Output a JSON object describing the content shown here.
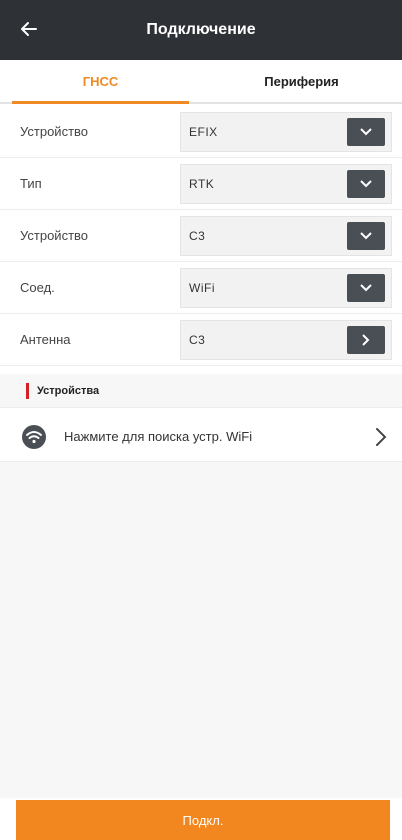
{
  "header": {
    "title": "Подключение",
    "back_icon": "arrow-left-icon"
  },
  "tabs": [
    {
      "label": "ГНСС",
      "active": true
    },
    {
      "label": "Периферия",
      "active": false
    }
  ],
  "rows": [
    {
      "label": "Устройство",
      "value": "EFIX",
      "action_icon": "chevron-down-icon"
    },
    {
      "label": "Тип",
      "value": "RTK",
      "action_icon": "chevron-down-icon"
    },
    {
      "label": "Устройство",
      "value": "C3",
      "action_icon": "chevron-down-icon"
    },
    {
      "label": "Соед.",
      "value": "WiFi",
      "action_icon": "chevron-down-icon"
    },
    {
      "label": "Антенна",
      "value": "C3",
      "action_icon": "chevron-right-icon"
    }
  ],
  "devices_section": {
    "title": "Устройства"
  },
  "wifi_search": {
    "label": "Нажмите для поиска устр. WiFi",
    "icon": "wifi-icon"
  },
  "footer": {
    "connect_label": "Подкл."
  },
  "colors": {
    "accent": "#ef8a25",
    "header_bg": "#2e3136",
    "section_marker": "#d42222",
    "button_bg": "#f2861f"
  }
}
